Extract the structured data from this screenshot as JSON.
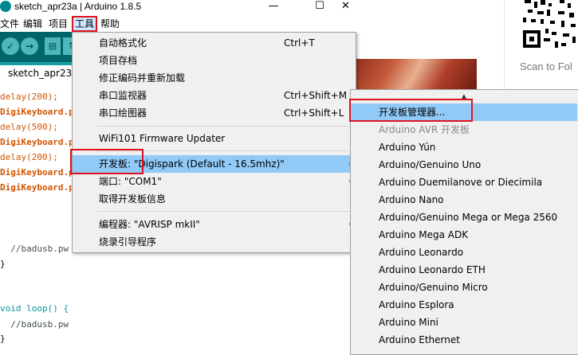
{
  "browser": {
    "scan_text": "Scan to Fol"
  },
  "window": {
    "title": "sketch_apr23a | Arduino 1.8.5",
    "minimize": "—",
    "maximize": "☐",
    "close": "✕"
  },
  "menubar": {
    "items": [
      "文件",
      "编辑",
      "项目",
      "工具",
      "帮助"
    ]
  },
  "toolbar": {
    "verify": "✓",
    "upload": "→",
    "new": "▤",
    "open": "↑",
    "save": "↓"
  },
  "editor": {
    "tab": "sketch_apr23a",
    "lines": [
      {
        "pre": "",
        "cls": "plain",
        "text": "delay(200);"
      },
      {
        "pre": "",
        "cls": "obj",
        "text": "DigiKeyboard.p"
      },
      {
        "pre": "",
        "cls": "plain",
        "text": "delay(500);"
      },
      {
        "pre": "",
        "cls": "obj",
        "text": "DigiKeyboard.p"
      },
      {
        "pre": "",
        "cls": "plain",
        "text": "delay(200);"
      },
      {
        "pre": "",
        "cls": "obj",
        "text": "DigiKeyboard.p"
      },
      {
        "pre": "",
        "cls": "obj",
        "text": "DigiKeyboard.p"
      }
    ],
    "comment1": "  //badusb.pw",
    "brace1": "}",
    "loop_sig": "void loop() {",
    "comment2": "  //badusb.pw",
    "brace2": "}"
  },
  "tools_menu": {
    "items": [
      {
        "label": "自动格式化",
        "shortcut": "Ctrl+T",
        "arrow": ""
      },
      {
        "label": "项目存档",
        "shortcut": "",
        "arrow": ""
      },
      {
        "label": "修正编码并重新加载",
        "shortcut": "",
        "arrow": ""
      },
      {
        "label": "串口监视器",
        "shortcut": "Ctrl+Shift+M",
        "arrow": ""
      },
      {
        "label": "串口绘图器",
        "shortcut": "Ctrl+Shift+L",
        "arrow": ""
      },
      {
        "label": "WiFi101 Firmware Updater",
        "shortcut": "",
        "arrow": ""
      },
      {
        "label": "开发板: \"Digispark (Default - 16.5mhz)\"",
        "shortcut": "",
        "arrow": "›"
      },
      {
        "label": "端口: \"COM1\"",
        "shortcut": "",
        "arrow": "›"
      },
      {
        "label": "取得开发板信息",
        "shortcut": "",
        "arrow": ""
      },
      {
        "label": "编程器: \"AVRISP mkII\"",
        "shortcut": "",
        "arrow": "›"
      },
      {
        "label": "烧录引导程序",
        "shortcut": "",
        "arrow": ""
      }
    ]
  },
  "board_menu": {
    "scroll_up": "▲",
    "items": [
      {
        "label": "开发板管理器..."
      },
      {
        "label": "Arduino AVR 开发板"
      },
      {
        "label": "Arduino Yún"
      },
      {
        "label": "Arduino/Genuino Uno"
      },
      {
        "label": "Arduino Duemilanove or Diecimila"
      },
      {
        "label": "Arduino Nano"
      },
      {
        "label": "Arduino/Genuino Mega or Mega 2560"
      },
      {
        "label": "Arduino Mega ADK"
      },
      {
        "label": "Arduino Leonardo"
      },
      {
        "label": "Arduino Leonardo ETH"
      },
      {
        "label": "Arduino/Genuino Micro"
      },
      {
        "label": "Arduino Esplora"
      },
      {
        "label": "Arduino Mini"
      },
      {
        "label": "Arduino Ethernet"
      }
    ]
  },
  "colors": {
    "toolbar": "#006468",
    "tabbar": "#17a1a5",
    "highlight": "#91c9f7",
    "annotation": "#e0141e"
  }
}
